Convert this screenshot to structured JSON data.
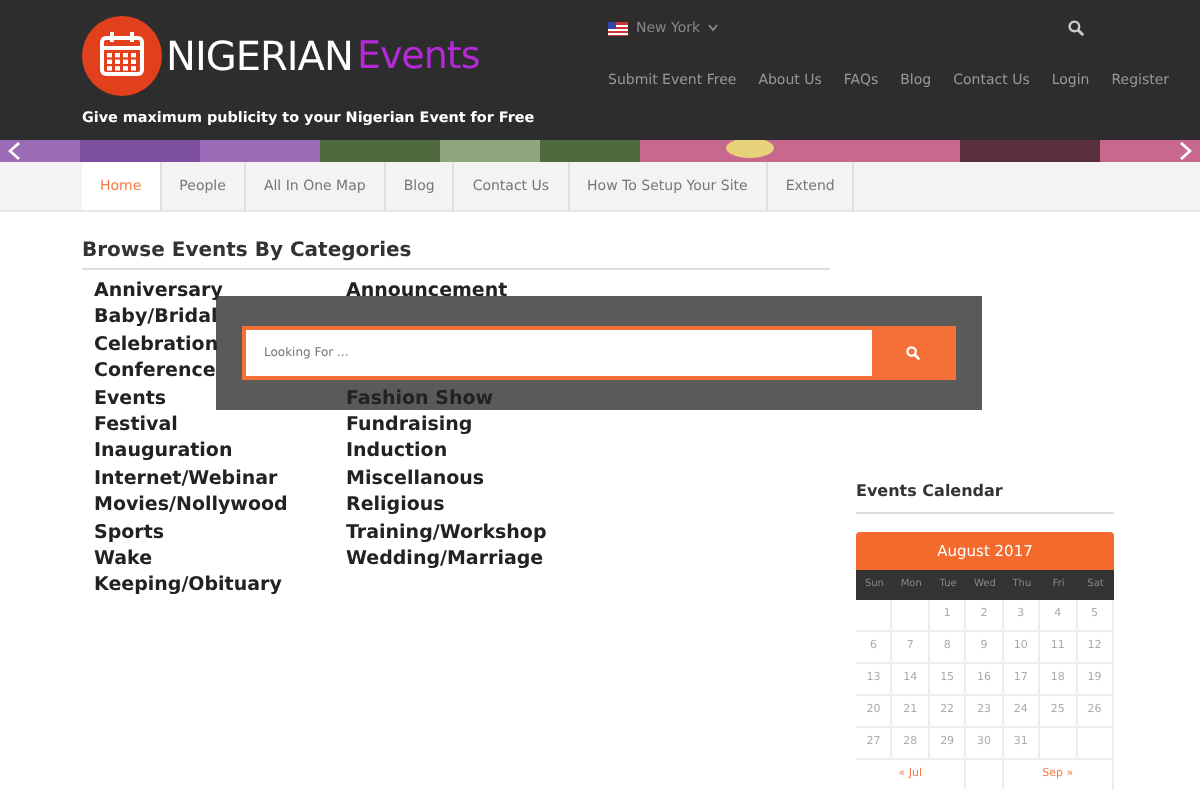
{
  "header": {
    "logo": {
      "name": "NIGERIAN",
      "accent": "Events"
    },
    "tagline": "Give maximum publicity to your Nigerian Event for Free",
    "location": "New York",
    "menu": [
      "Submit Event Free",
      "About Us",
      "FAQs",
      "Blog",
      "Contact Us",
      "Login",
      "Register"
    ]
  },
  "tabs": [
    {
      "label": "Home",
      "selected": true
    },
    {
      "label": "People",
      "selected": false
    },
    {
      "label": "All In One Map",
      "selected": false
    },
    {
      "label": "Blog",
      "selected": false
    },
    {
      "label": "Contact Us",
      "selected": false
    },
    {
      "label": "How To Setup Your Site",
      "selected": false
    },
    {
      "label": "Extend",
      "selected": false
    }
  ],
  "categories": {
    "title": "Browse Events By Categories",
    "columns": [
      [
        "Anniversary",
        "Baby/Bridal",
        "Celebration",
        "Conference",
        "Events",
        "Festival",
        "Inauguration",
        "Internet/Webinar",
        "Movies/Nollywood",
        "Sports",
        "Wake Keeping/Obituary"
      ],
      [
        "Announcement",
        null,
        null,
        null,
        "Fashion Show",
        "Fundraising",
        "Induction",
        "Miscellanous",
        "Religious",
        "Training/Workshop",
        "Wedding/Marriage"
      ]
    ]
  },
  "search_overlay": {
    "placeholder": "Looking For ..."
  },
  "calendar": {
    "title": "Events Calendar",
    "month": "August 2017",
    "weekdays": [
      "Sun",
      "Mon",
      "Tue",
      "Wed",
      "Thu",
      "Fri",
      "Sat"
    ],
    "weeks": [
      {
        "kind": "first",
        "days": [
          "1",
          "2",
          "3",
          "4",
          "5"
        ]
      },
      {
        "kind": "full",
        "days": [
          "6",
          "7",
          "8",
          "9",
          "10",
          "11",
          "12"
        ]
      },
      {
        "kind": "full",
        "days": [
          "13",
          "14",
          "15",
          "16",
          "17",
          "18",
          "19"
        ]
      },
      {
        "kind": "full",
        "days": [
          "20",
          "21",
          "22",
          "23",
          "24",
          "25",
          "26"
        ]
      },
      {
        "kind": "last",
        "days": [
          "27",
          "28",
          "29",
          "30",
          "31"
        ]
      }
    ],
    "prev": "« Jul",
    "next": "Sep »"
  }
}
